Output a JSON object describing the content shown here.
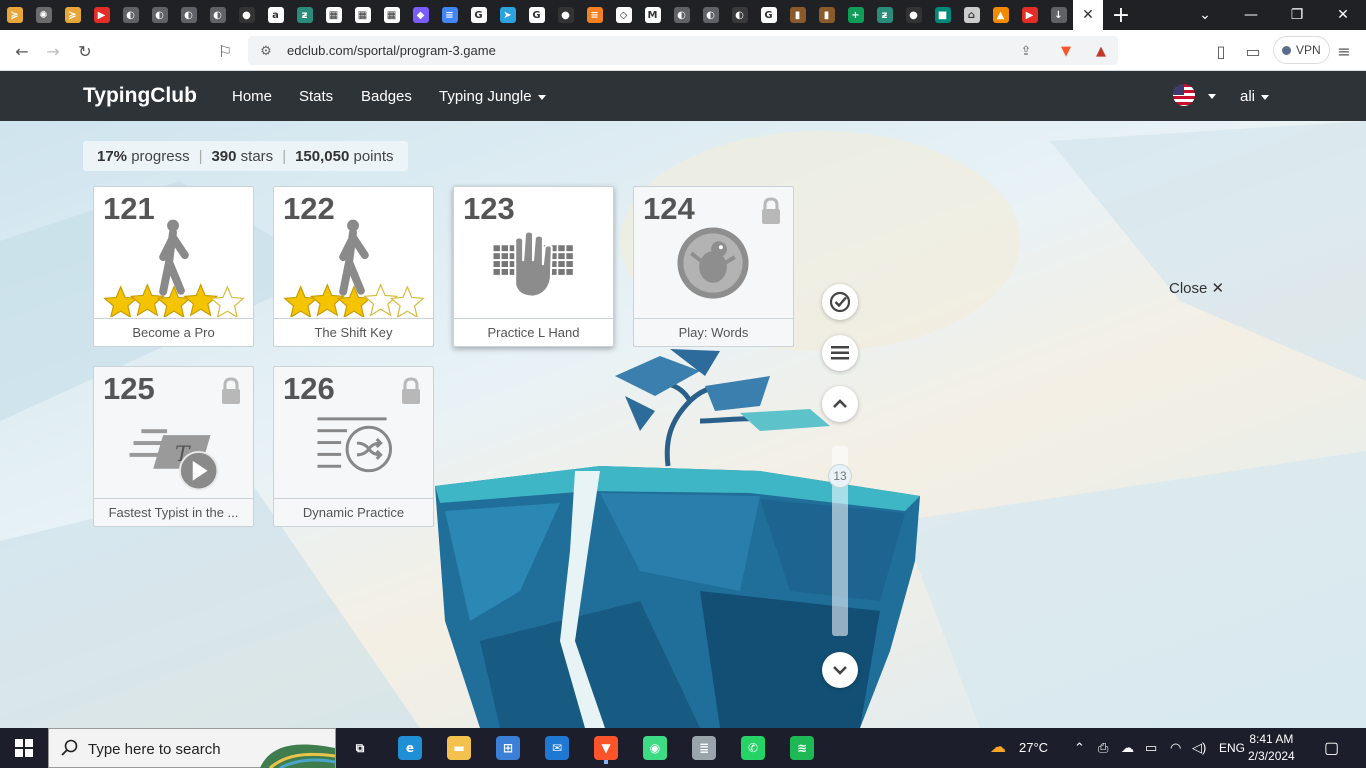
{
  "browser": {
    "tabs": [
      {
        "icon": "arrow-app-icon",
        "color": "#e8a53a",
        "glyph": "≽"
      },
      {
        "icon": "chatgpt-icon",
        "color": "#6b6b6b",
        "glyph": "✺"
      },
      {
        "icon": "arrow-app-icon",
        "color": "#e8a53a",
        "glyph": "≽"
      },
      {
        "icon": "youtube-icon",
        "color": "#e52d27",
        "glyph": "▶"
      },
      {
        "icon": "globe-icon",
        "color": "#5f6368",
        "glyph": "◐"
      },
      {
        "icon": "globe-icon",
        "color": "#5f6368",
        "glyph": "◐"
      },
      {
        "icon": "globe-icon",
        "color": "#5f6368",
        "glyph": "◐"
      },
      {
        "icon": "globe-icon",
        "color": "#5f6368",
        "glyph": "◐"
      },
      {
        "icon": "github-icon",
        "color": "#333333",
        "glyph": "●"
      },
      {
        "icon": "amazon-icon",
        "color": "#ffffff",
        "glyph": "a"
      },
      {
        "icon": "typingclub-icon",
        "color": "#2a8c7a",
        "glyph": "ƶ"
      },
      {
        "icon": "qr-icon",
        "color": "#ffffff",
        "glyph": "▦"
      },
      {
        "icon": "qr-icon",
        "color": "#ffffff",
        "glyph": "▦"
      },
      {
        "icon": "qr-icon",
        "color": "#ffffff",
        "glyph": "▦"
      },
      {
        "icon": "copilot-icon",
        "color": "#7a5cff",
        "glyph": "◆"
      },
      {
        "icon": "google-docs-icon",
        "color": "#4285f4",
        "glyph": "≡"
      },
      {
        "icon": "google-icon",
        "color": "#ffffff",
        "glyph": "G"
      },
      {
        "icon": "telegram-icon",
        "color": "#2aa3df",
        "glyph": "➤"
      },
      {
        "icon": "google-icon",
        "color": "#ffffff",
        "glyph": "G"
      },
      {
        "icon": "github-icon",
        "color": "#333333",
        "glyph": "●"
      },
      {
        "icon": "stackoverflow-icon",
        "color": "#f48024",
        "glyph": "≡"
      },
      {
        "icon": "codepen-icon",
        "color": "#ffffff",
        "glyph": "◇"
      },
      {
        "icon": "gmail-icon",
        "color": "#ffffff",
        "glyph": "M"
      },
      {
        "icon": "globe-icon",
        "color": "#5f6368",
        "glyph": "◐"
      },
      {
        "icon": "globe-icon",
        "color": "#5f6368",
        "glyph": "◐"
      },
      {
        "icon": "globe-icon",
        "color": "#3a3a3a",
        "glyph": "◐"
      },
      {
        "icon": "google-icon",
        "color": "#ffffff",
        "glyph": "G"
      },
      {
        "icon": "book-icon",
        "color": "#8a5a2b",
        "glyph": "▮"
      },
      {
        "icon": "book-icon",
        "color": "#8a5a2b",
        "glyph": "▮"
      },
      {
        "icon": "sheets-icon",
        "color": "#0f9d58",
        "glyph": "+"
      },
      {
        "icon": "typingclub-icon",
        "color": "#2a8c7a",
        "glyph": "ƶ"
      },
      {
        "icon": "github-icon",
        "color": "#333333",
        "glyph": "●"
      },
      {
        "icon": "meet-icon",
        "color": "#00897b",
        "glyph": "■"
      },
      {
        "icon": "bank-icon",
        "color": "#cccccc",
        "glyph": "⌂"
      },
      {
        "icon": "vlc-icon",
        "color": "#f08a00",
        "glyph": "▲"
      },
      {
        "icon": "youtube-icon",
        "color": "#e52d27",
        "glyph": "▶"
      },
      {
        "icon": "download-icon",
        "color": "#5f6368",
        "glyph": "↓"
      }
    ],
    "active_tab_icon": "close-icon",
    "active_tab_glyph": "✕",
    "url": "edclub.com/sportal/program-3.game",
    "vpn_label": "VPN",
    "brave_badge": "1",
    "rewards_badge": "1"
  },
  "site": {
    "brand": "TypingClub",
    "nav": [
      "Home",
      "Stats",
      "Badges",
      "Typing Jungle"
    ],
    "user": "ali"
  },
  "progress": {
    "percent": "17%",
    "percent_label": "progress",
    "stars": "390",
    "stars_label": "stars",
    "points": "150,050",
    "points_label": "points"
  },
  "lessons": [
    {
      "number": "121",
      "title": "Become a Pro",
      "art": "walker",
      "stars_earned": 4,
      "stars_total": 5,
      "locked": false
    },
    {
      "number": "122",
      "title": "The Shift Key",
      "art": "walker",
      "stars_earned": 3,
      "stars_total": 5,
      "locked": false
    },
    {
      "number": "123",
      "title": "Practice L Hand",
      "art": "keyboard-hand",
      "locked": false,
      "selected": true
    },
    {
      "number": "124",
      "title": "Play: Words",
      "art": "game-bird",
      "locked": true
    },
    {
      "number": "125",
      "title": "Fastest Typist in the ...",
      "art": "video-typist",
      "locked": true
    },
    {
      "number": "126",
      "title": "Dynamic Practice",
      "art": "shuffle-lines",
      "locked": true
    }
  ],
  "sidebar": {
    "page_indicator": "13"
  },
  "close_label": "Close",
  "close_glyph": "✕",
  "taskbar": {
    "search_placeholder": "Type here to search",
    "weather": "27°C",
    "language": "ENG",
    "time": "8:41 AM",
    "date": "2/3/2024",
    "apps": [
      {
        "icon": "task-view-icon",
        "color": "#1c1f2b",
        "glyph": "⧉"
      },
      {
        "icon": "edge-icon",
        "color": "#1f8fd6",
        "glyph": "e"
      },
      {
        "icon": "file-explorer-icon",
        "color": "#f2c14e",
        "glyph": "▬"
      },
      {
        "icon": "store-icon",
        "color": "#3b7fd6",
        "glyph": "⊞"
      },
      {
        "icon": "mail-icon",
        "color": "#1f78d1",
        "glyph": "✉"
      },
      {
        "icon": "brave-icon",
        "color": "#fb542b",
        "glyph": "▼"
      },
      {
        "icon": "android-icon",
        "color": "#3ddc84",
        "glyph": "◉"
      },
      {
        "icon": "database-icon",
        "color": "#9aa4ad",
        "glyph": "≣"
      },
      {
        "icon": "whatsapp-icon",
        "color": "#25d366",
        "glyph": "✆"
      },
      {
        "icon": "spotify-icon",
        "color": "#1db954",
        "glyph": "≋"
      }
    ]
  }
}
